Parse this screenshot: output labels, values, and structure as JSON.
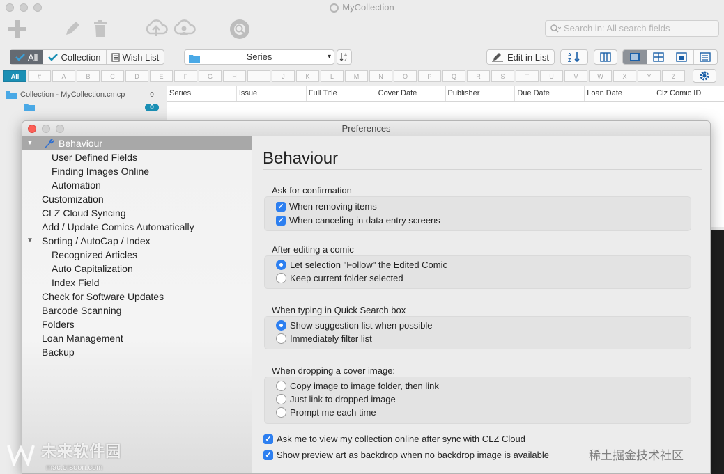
{
  "app": {
    "title": "MyCollection",
    "search_placeholder": "Search in: All search fields",
    "collection_tabs": [
      "All",
      "Collection",
      "Wish List"
    ],
    "series_select": "Series",
    "edit_in_list": "Edit in List",
    "alphabet": [
      "All",
      "#",
      "A",
      "B",
      "C",
      "D",
      "E",
      "F",
      "G",
      "H",
      "I",
      "J",
      "K",
      "L",
      "M",
      "N",
      "O",
      "P",
      "Q",
      "R",
      "S",
      "T",
      "U",
      "V",
      "W",
      "X",
      "Y",
      "Z"
    ],
    "tree": {
      "root_label": "Collection - MyCollection.cmcp",
      "root_count": "0",
      "child_count": "0"
    },
    "columns": [
      "Series",
      "Issue",
      "Full Title",
      "Cover Date",
      "Publisher",
      "Due Date",
      "Loan Date",
      "Clz Comic ID"
    ]
  },
  "preferences": {
    "window_title": "Preferences",
    "sidebar": [
      {
        "label": "Behaviour",
        "level": 0,
        "selected": true,
        "expandable": true
      },
      {
        "label": "User Defined Fields",
        "level": 2
      },
      {
        "label": "Finding Images Online",
        "level": 2
      },
      {
        "label": "Automation",
        "level": 2
      },
      {
        "label": "Customization",
        "level": 1
      },
      {
        "label": "CLZ Cloud Syncing",
        "level": 1
      },
      {
        "label": "Add / Update Comics Automatically",
        "level": 1
      },
      {
        "label": "Sorting / AutoCap / Index",
        "level": 1,
        "expandable": true
      },
      {
        "label": "Recognized Articles",
        "level": 2
      },
      {
        "label": "Auto Capitalization",
        "level": 2
      },
      {
        "label": "Index Field",
        "level": 2
      },
      {
        "label": "Check for Software Updates",
        "level": 1
      },
      {
        "label": "Barcode Scanning",
        "level": 1
      },
      {
        "label": "Folders",
        "level": 1
      },
      {
        "label": "Loan Management",
        "level": 1
      },
      {
        "label": "Backup",
        "level": 1
      }
    ],
    "heading": "Behaviour",
    "groups": {
      "confirm": {
        "label": "Ask for confirmation",
        "options": [
          {
            "label": "When removing items",
            "checked": true
          },
          {
            "label": "When canceling in data entry screens",
            "checked": true
          }
        ]
      },
      "after_edit": {
        "label": "After editing a comic",
        "options": [
          {
            "label": "Let selection \"Follow\" the Edited Comic",
            "selected": true
          },
          {
            "label": "Keep current folder selected",
            "selected": false
          }
        ]
      },
      "quick_search": {
        "label": "When typing in Quick Search box",
        "options": [
          {
            "label": "Show suggestion list when possible",
            "selected": true
          },
          {
            "label": "Immediately filter list",
            "selected": false
          }
        ]
      },
      "drop_cover": {
        "label": "When dropping a cover image:",
        "options": [
          {
            "label": "Copy image to image folder, then link",
            "selected": false
          },
          {
            "label": "Just link to dropped image",
            "selected": false
          },
          {
            "label": "Prompt me each time",
            "selected": false
          }
        ]
      }
    },
    "extra_checks": [
      {
        "label": "Ask me to view my collection online after sync with CLZ Cloud",
        "checked": true
      },
      {
        "label": "Show preview art as backdrop when no backdrop image is available",
        "checked": true
      }
    ]
  },
  "watermarks": {
    "left_main": "未来软件园",
    "left_sub": "mac.orsoon.com",
    "right": "稀土掘金技术社区"
  },
  "colors": {
    "accent_blue": "#2d7ff0",
    "teal": "#1a8fb4",
    "sidebar_selected": "#a8a8a8"
  }
}
